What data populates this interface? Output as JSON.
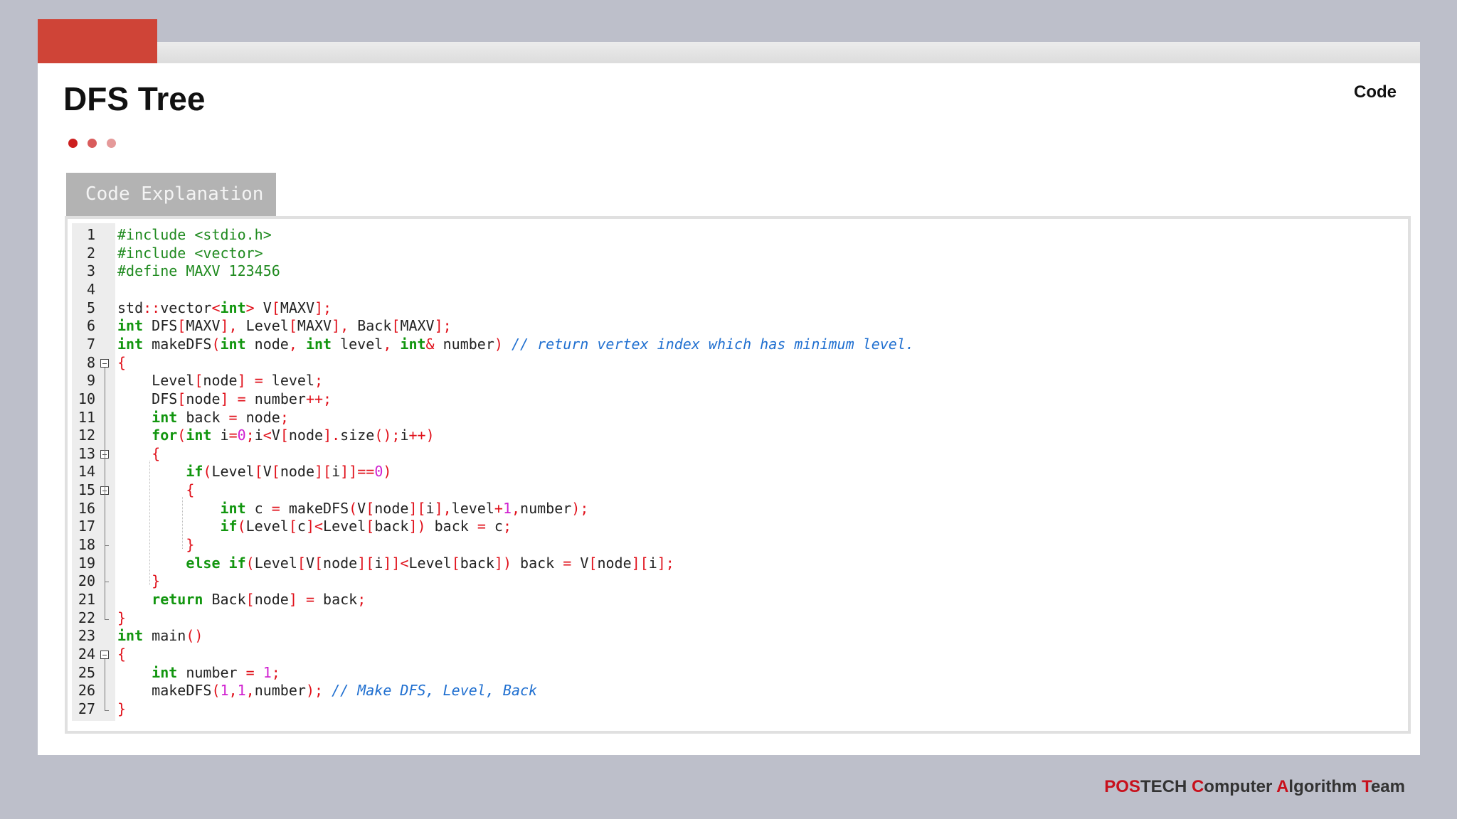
{
  "slide": {
    "title": "DFS Tree",
    "section_tag": "Code",
    "dots": [
      "#cc1f1f",
      "#d95c5c",
      "#e59a9a"
    ],
    "subtab": "Code Explanation"
  },
  "code": {
    "line_numbers": [
      "1",
      "2",
      "3",
      "4",
      "5",
      "6",
      "7",
      "8",
      "9",
      "10",
      "11",
      "12",
      "13",
      "14",
      "15",
      "16",
      "17",
      "18",
      "19",
      "20",
      "21",
      "22",
      "23",
      "24",
      "25",
      "26",
      "27"
    ],
    "lines": [
      [
        [
          "pp",
          "#include <stdio.h>"
        ]
      ],
      [
        [
          "pp",
          "#include <vector>"
        ]
      ],
      [
        [
          "pp",
          "#define MAXV 123456"
        ]
      ],
      [],
      [
        [
          "t",
          "std"
        ],
        [
          "op",
          "::"
        ],
        [
          "t",
          "vector"
        ],
        [
          "op",
          "<"
        ],
        [
          "kw",
          "int"
        ],
        [
          "op",
          ">"
        ],
        [
          "t",
          " V"
        ],
        [
          "op",
          "["
        ],
        [
          "t",
          "MAXV"
        ],
        [
          "op",
          "];"
        ]
      ],
      [
        [
          "kw",
          "int"
        ],
        [
          "t",
          " DFS"
        ],
        [
          "op",
          "["
        ],
        [
          "t",
          "MAXV"
        ],
        [
          "op",
          "],"
        ],
        [
          "t",
          " Level"
        ],
        [
          "op",
          "["
        ],
        [
          "t",
          "MAXV"
        ],
        [
          "op",
          "],"
        ],
        [
          "t",
          " Back"
        ],
        [
          "op",
          "["
        ],
        [
          "t",
          "MAXV"
        ],
        [
          "op",
          "];"
        ]
      ],
      [
        [
          "kw",
          "int"
        ],
        [
          "t",
          " makeDFS"
        ],
        [
          "op",
          "("
        ],
        [
          "kw",
          "int"
        ],
        [
          "t",
          " node"
        ],
        [
          "op",
          ","
        ],
        [
          "t",
          " "
        ],
        [
          "kw",
          "int"
        ],
        [
          "t",
          " level"
        ],
        [
          "op",
          ","
        ],
        [
          "t",
          " "
        ],
        [
          "kw",
          "int"
        ],
        [
          "op",
          "&"
        ],
        [
          "t",
          " number"
        ],
        [
          "op",
          ")"
        ],
        [
          "t",
          " "
        ],
        [
          "cm",
          "// return vertex index which has minimum level."
        ]
      ],
      [
        [
          "op",
          "{"
        ]
      ],
      [
        [
          "t",
          "    Level"
        ],
        [
          "op",
          "["
        ],
        [
          "t",
          "node"
        ],
        [
          "op",
          "]"
        ],
        [
          "t",
          " "
        ],
        [
          "op",
          "="
        ],
        [
          "t",
          " level"
        ],
        [
          "op",
          ";"
        ]
      ],
      [
        [
          "t",
          "    DFS"
        ],
        [
          "op",
          "["
        ],
        [
          "t",
          "node"
        ],
        [
          "op",
          "]"
        ],
        [
          "t",
          " "
        ],
        [
          "op",
          "="
        ],
        [
          "t",
          " number"
        ],
        [
          "op",
          "++;"
        ]
      ],
      [
        [
          "t",
          "    "
        ],
        [
          "kw",
          "int"
        ],
        [
          "t",
          " back "
        ],
        [
          "op",
          "="
        ],
        [
          "t",
          " node"
        ],
        [
          "op",
          ";"
        ]
      ],
      [
        [
          "t",
          "    "
        ],
        [
          "kw",
          "for"
        ],
        [
          "op",
          "("
        ],
        [
          "kw",
          "int"
        ],
        [
          "t",
          " i"
        ],
        [
          "op",
          "="
        ],
        [
          "num",
          "0"
        ],
        [
          "op",
          ";"
        ],
        [
          "t",
          "i"
        ],
        [
          "op",
          "<"
        ],
        [
          "t",
          "V"
        ],
        [
          "op",
          "["
        ],
        [
          "t",
          "node"
        ],
        [
          "op",
          "]."
        ],
        [
          "t",
          "size"
        ],
        [
          "op",
          "();"
        ],
        [
          "t",
          "i"
        ],
        [
          "op",
          "++)"
        ]
      ],
      [
        [
          "t",
          "    "
        ],
        [
          "op",
          "{"
        ]
      ],
      [
        [
          "t",
          "        "
        ],
        [
          "kw",
          "if"
        ],
        [
          "op",
          "("
        ],
        [
          "t",
          "Level"
        ],
        [
          "op",
          "["
        ],
        [
          "t",
          "V"
        ],
        [
          "op",
          "["
        ],
        [
          "t",
          "node"
        ],
        [
          "op",
          "]["
        ],
        [
          "t",
          "i"
        ],
        [
          "op",
          "]]=="
        ],
        [
          "num",
          "0"
        ],
        [
          "op",
          ")"
        ]
      ],
      [
        [
          "t",
          "        "
        ],
        [
          "op",
          "{"
        ]
      ],
      [
        [
          "t",
          "            "
        ],
        [
          "kw",
          "int"
        ],
        [
          "t",
          " c "
        ],
        [
          "op",
          "="
        ],
        [
          "t",
          " makeDFS"
        ],
        [
          "op",
          "("
        ],
        [
          "t",
          "V"
        ],
        [
          "op",
          "["
        ],
        [
          "t",
          "node"
        ],
        [
          "op",
          "]["
        ],
        [
          "t",
          "i"
        ],
        [
          "op",
          "],"
        ],
        [
          "t",
          "level"
        ],
        [
          "op",
          "+"
        ],
        [
          "num",
          "1"
        ],
        [
          "op",
          ","
        ],
        [
          "t",
          "number"
        ],
        [
          "op",
          ");"
        ]
      ],
      [
        [
          "t",
          "            "
        ],
        [
          "kw",
          "if"
        ],
        [
          "op",
          "("
        ],
        [
          "t",
          "Level"
        ],
        [
          "op",
          "["
        ],
        [
          "t",
          "c"
        ],
        [
          "op",
          "]<"
        ],
        [
          "t",
          "Level"
        ],
        [
          "op",
          "["
        ],
        [
          "t",
          "back"
        ],
        [
          "op",
          "])"
        ],
        [
          "t",
          " back "
        ],
        [
          "op",
          "="
        ],
        [
          "t",
          " c"
        ],
        [
          "op",
          ";"
        ]
      ],
      [
        [
          "t",
          "        "
        ],
        [
          "op",
          "}"
        ]
      ],
      [
        [
          "t",
          "        "
        ],
        [
          "kw",
          "else"
        ],
        [
          "t",
          " "
        ],
        [
          "kw",
          "if"
        ],
        [
          "op",
          "("
        ],
        [
          "t",
          "Level"
        ],
        [
          "op",
          "["
        ],
        [
          "t",
          "V"
        ],
        [
          "op",
          "["
        ],
        [
          "t",
          "node"
        ],
        [
          "op",
          "]["
        ],
        [
          "t",
          "i"
        ],
        [
          "op",
          "]]<"
        ],
        [
          "t",
          "Level"
        ],
        [
          "op",
          "["
        ],
        [
          "t",
          "back"
        ],
        [
          "op",
          "])"
        ],
        [
          "t",
          " back "
        ],
        [
          "op",
          "="
        ],
        [
          "t",
          " V"
        ],
        [
          "op",
          "["
        ],
        [
          "t",
          "node"
        ],
        [
          "op",
          "]["
        ],
        [
          "t",
          "i"
        ],
        [
          "op",
          "];"
        ]
      ],
      [
        [
          "t",
          "    "
        ],
        [
          "op",
          "}"
        ]
      ],
      [
        [
          "t",
          "    "
        ],
        [
          "kw",
          "return"
        ],
        [
          "t",
          " Back"
        ],
        [
          "op",
          "["
        ],
        [
          "t",
          "node"
        ],
        [
          "op",
          "]"
        ],
        [
          "t",
          " "
        ],
        [
          "op",
          "="
        ],
        [
          "t",
          " back"
        ],
        [
          "op",
          ";"
        ]
      ],
      [
        [
          "op",
          "}"
        ]
      ],
      [
        [
          "kw",
          "int"
        ],
        [
          "t",
          " main"
        ],
        [
          "op",
          "()"
        ]
      ],
      [
        [
          "op",
          "{"
        ]
      ],
      [
        [
          "t",
          "    "
        ],
        [
          "kw",
          "int"
        ],
        [
          "t",
          " number "
        ],
        [
          "op",
          "="
        ],
        [
          "t",
          " "
        ],
        [
          "num",
          "1"
        ],
        [
          "op",
          ";"
        ]
      ],
      [
        [
          "t",
          "    makeDFS"
        ],
        [
          "op",
          "("
        ],
        [
          "num",
          "1"
        ],
        [
          "op",
          ","
        ],
        [
          "num",
          "1"
        ],
        [
          "op",
          ","
        ],
        [
          "t",
          "number"
        ],
        [
          "op",
          ");"
        ],
        [
          "t",
          " "
        ],
        [
          "cm",
          "// Make DFS, Level, Back"
        ]
      ],
      [
        [
          "op",
          "}"
        ]
      ]
    ]
  },
  "footer": {
    "parts": [
      {
        "text": "POS",
        "accent": true
      },
      {
        "text": "TECH ",
        "accent": false
      },
      {
        "text": "C",
        "accent": true
      },
      {
        "text": "omputer ",
        "accent": false
      },
      {
        "text": "A",
        "accent": true
      },
      {
        "text": "lgorithm ",
        "accent": false
      },
      {
        "text": "T",
        "accent": true
      },
      {
        "text": "eam",
        "accent": false
      }
    ]
  }
}
